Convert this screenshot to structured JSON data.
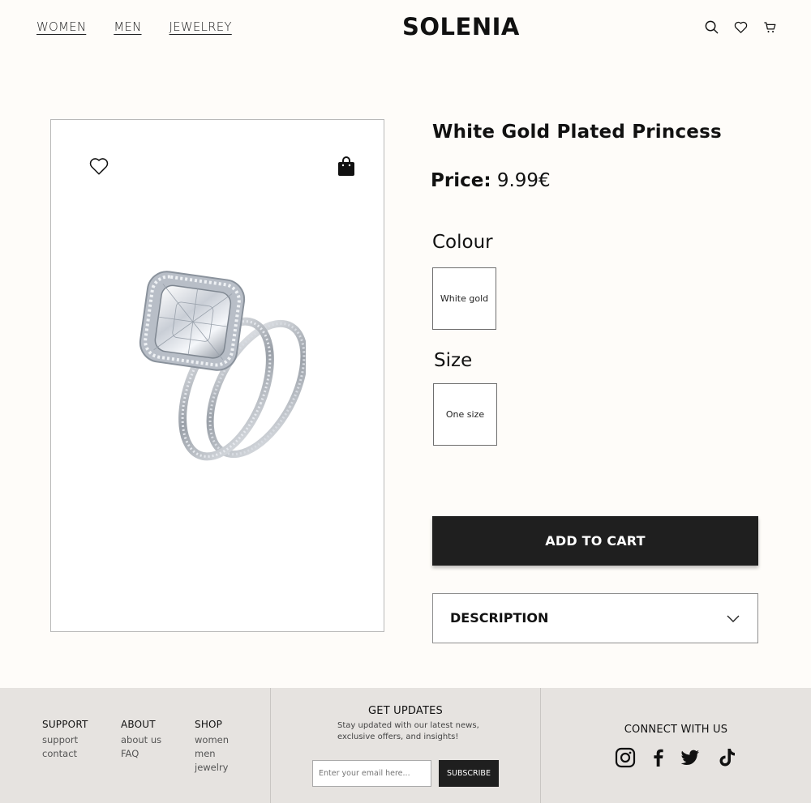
{
  "nav": {
    "women": "WOMEN",
    "men": "MEN",
    "jewelry": "JEWELREY"
  },
  "brand": "SOLENIA",
  "header_icons": [
    "search-icon",
    "heart-icon",
    "cart-icon"
  ],
  "product": {
    "title": "White Gold Plated Princess",
    "price_label": "Price:",
    "price_value": "9.99€",
    "colour_label": "Colour",
    "colour_option": "White gold",
    "size_label": "Size",
    "size_option": "One size",
    "add_to_cart": "ADD TO CART",
    "description_label": "DESCRIPTION"
  },
  "footer": {
    "support": {
      "title": "SUPPORT",
      "links": [
        "support",
        "contact"
      ]
    },
    "about": {
      "title": "ABOUT",
      "links": [
        "about us",
        "FAQ"
      ]
    },
    "shop": {
      "title": "SHOP",
      "links": [
        "women",
        "men",
        "jewelry"
      ]
    },
    "updates": {
      "title": "GET UPDATES",
      "text": "Stay updated with our latest news, exclusive offers, and insights!",
      "placeholder": "Enter your email here...",
      "button": "SUBSCRIBE"
    },
    "connect": "CONNECT WITH US",
    "social_icons": [
      "instagram-icon",
      "facebook-icon",
      "twitter-icon",
      "tiktok-icon"
    ]
  },
  "colors": {
    "page_bg": "#fefcf9",
    "footer_bg": "#e6e3e0",
    "button_bg": "#1f1f1f"
  }
}
